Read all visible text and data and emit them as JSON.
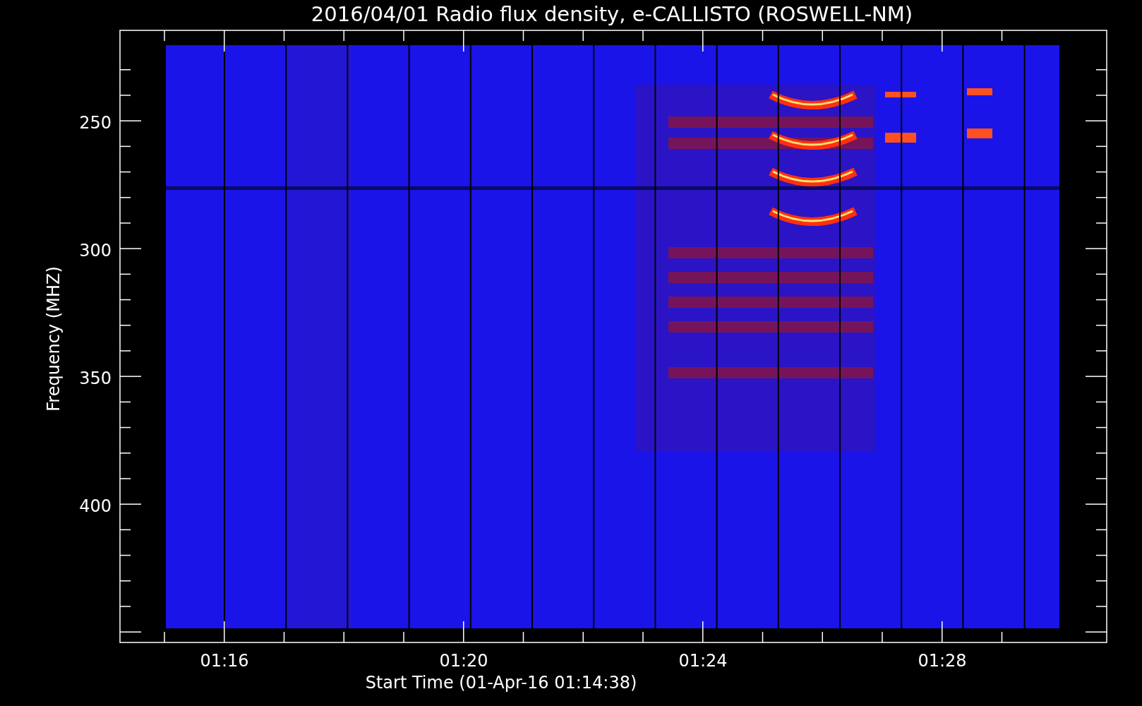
{
  "title": "2016/04/01  Radio flux density, e-CALLISTO (ROSWELL-NM)",
  "plot": {
    "y_label": "Frequency (MHZ)",
    "x_label": "Start Time (01-Apr-16 01:14:38)",
    "y_ticks": [
      "250",
      "300",
      "350",
      "400"
    ],
    "x_ticks": [
      "01:16",
      "01:20",
      "01:24",
      "01:28"
    ]
  }
}
